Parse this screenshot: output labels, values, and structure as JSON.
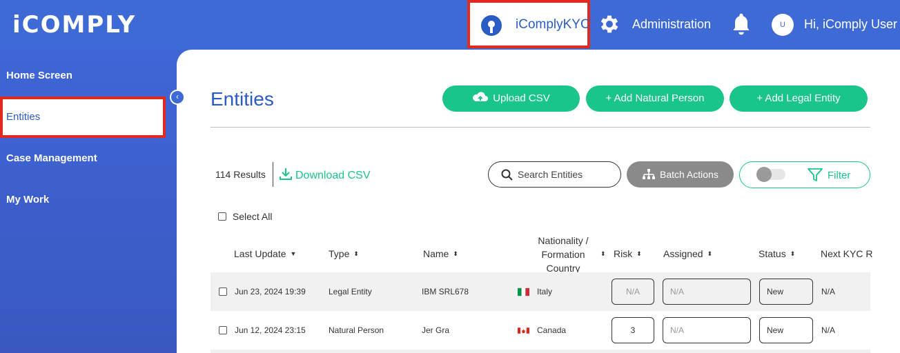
{
  "header": {
    "logo": "iCOMPLY",
    "app_switch_label": "iComplyKYC",
    "admin_label": "Administration",
    "avatar_initial": "U",
    "greeting": "Hi, iComply User"
  },
  "sidebar": {
    "items": [
      {
        "label": "Home Screen",
        "active": false
      },
      {
        "label": "Entities",
        "active": true
      },
      {
        "label": "Case Management",
        "active": false
      },
      {
        "label": "My Work",
        "active": false
      }
    ],
    "collapse_glyph": "‹"
  },
  "main": {
    "title": "Entities",
    "upload_csv_label": "Upload CSV",
    "add_natural_label": "+ Add Natural Person",
    "add_legal_label": "+ Add Legal Entity",
    "results_label": "114 Results",
    "download_label": "Download CSV",
    "search_placeholder": "Search Entities",
    "batch_label": "Batch Actions",
    "filter_label": "Filter",
    "filter_toggle_on": false,
    "select_all_label": "Select All"
  },
  "table": {
    "columns": {
      "last_update": "Last Update",
      "type": "Type",
      "name": "Name",
      "nationality_1": "Nationality /",
      "nationality_2": "Formation",
      "nationality_3": "Country",
      "risk": "Risk",
      "assigned": "Assigned",
      "status": "Status",
      "next_kyc": "Next KYC R"
    },
    "rows": [
      {
        "last_update": "Jun 23, 2024 19:39",
        "type": "Legal Entity",
        "name": "IBM SRL678",
        "country": "Italy",
        "risk": "N/A",
        "assigned": "N/A",
        "status": "New",
        "next_kyc": "N/A"
      },
      {
        "last_update": "Jun 12, 2024 23:15",
        "type": "Natural Person",
        "name": "Jer Gra",
        "country": "Canada",
        "risk": "3",
        "assigned": "N/A",
        "status": "New",
        "next_kyc": "N/A"
      }
    ]
  },
  "colors": {
    "brand_blue": "#3e6ad6",
    "accent_green": "#19c58a",
    "highlight_red": "#e02a1e"
  }
}
